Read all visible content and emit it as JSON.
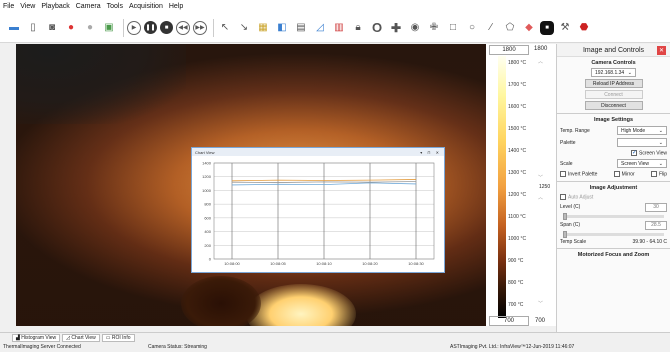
{
  "menu": [
    "File",
    "View",
    "Playback",
    "Camera",
    "Tools",
    "Acquisition",
    "Help"
  ],
  "toolbar_icons": [
    "folder-icon",
    "file-icon",
    "camera-icon",
    "record-icon",
    "record-dot-icon",
    "snapshot-icon",
    "play-icon",
    "pause-icon",
    "stop-icon",
    "rewind-icon",
    "forward-icon",
    "pointer-icon",
    "line-icon",
    "image-icon",
    "layer-icon",
    "grid-icon",
    "chart-icon",
    "table-icon",
    "lock-icon",
    "circle-icon",
    "move-icon",
    "eye-icon",
    "crosshair-icon",
    "square-icon",
    "ellipse-icon",
    "line-tool-icon",
    "polygon-icon",
    "diamond-icon",
    "stop-big-icon",
    "tools-icon",
    "alarm-icon"
  ],
  "scale": {
    "max_box": "1800",
    "max_label": "1800",
    "min_box": "700",
    "min_label": "700",
    "mid_value": "1250",
    "ticks": [
      "1800 °C",
      "1700 °C",
      "1600 °C",
      "1500 °C",
      "1400 °C",
      "1300 °C",
      "1200 °C",
      "1100 °C",
      "1000 °C",
      "900 °C",
      "800 °C",
      "700 °C"
    ]
  },
  "chart_window": {
    "title": "Chart View",
    "controls": "▾ ⊓ ✕"
  },
  "chart_data": {
    "type": "line",
    "x": [
      "10:08:00",
      "10:08:05",
      "10:08:10",
      "10:08:20",
      "10:08:30"
    ],
    "yticks": [
      0,
      200,
      400,
      600,
      800,
      1000,
      1200,
      1400
    ],
    "ylim": [
      0,
      1400
    ],
    "series": [
      {
        "color": "#e39b3c",
        "values": [
          1140,
          1150,
          1145,
          1150,
          1160
        ]
      },
      {
        "color": "#6ea8d8",
        "values": [
          1080,
          1090,
          1085,
          1110,
          1095
        ]
      },
      {
        "color": "#999999",
        "values": [
          1120,
          1115,
          1125,
          1120,
          1130
        ]
      }
    ]
  },
  "panel": {
    "title": "Image and Controls",
    "camera": {
      "section": "Camera Controls",
      "ip": "192.168.1.34",
      "reload": "Reload IP Address",
      "connect": "Connect",
      "disconnect": "Disconnect"
    },
    "image_settings": {
      "section": "Image Settings",
      "temp_range_label": "Temp. Range",
      "temp_range_value": "High Mode",
      "palette_label": "Palette",
      "palette_value": "",
      "screen_view_check": "Screen View",
      "scale_label": "Scale",
      "scale_value": "Screen View",
      "invert": "Invert Palette",
      "mirror": "Mirror",
      "flip": "Flip"
    },
    "adjustment": {
      "section": "Image Adjustment",
      "auto": "Auto Adjust",
      "level_label": "Level (C)",
      "level_value": "30",
      "span_label": "Span (C)",
      "span_value": "28.5",
      "temp_scale_label": "Temp Scale",
      "temp_scale_value": "39.90 - 64.10 C"
    },
    "focus_section": "Motorized Focus and Zoom"
  },
  "tabs": [
    "Histogram View",
    "Chart View",
    "ROI Info"
  ],
  "status": {
    "server": "ThermalImaging Server Connected",
    "camera": "Camera Status: Streaming",
    "company": "ASTImaging Pvt. Ltd.: InfraView™12-Jun-2019 11:46:07"
  }
}
